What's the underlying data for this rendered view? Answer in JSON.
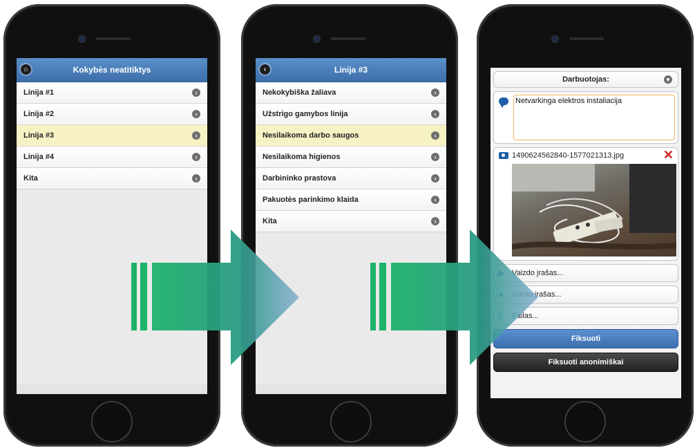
{
  "screen1": {
    "header_title": "Kokybės neatitiktys",
    "items": [
      {
        "label": "Linija #1",
        "selected": false
      },
      {
        "label": "Linija #2",
        "selected": false
      },
      {
        "label": "Linija #3",
        "selected": true
      },
      {
        "label": "Linija #4",
        "selected": false
      },
      {
        "label": "Kita",
        "selected": false
      }
    ]
  },
  "screen2": {
    "header_title": "Linija #3",
    "items": [
      {
        "label": "Nekokybiška žaliava",
        "selected": false
      },
      {
        "label": "Užstrigo gamybos linija",
        "selected": false
      },
      {
        "label": "Nesilaikoma darbo saugos",
        "selected": true
      },
      {
        "label": "Nesilaikoma higienos",
        "selected": false
      },
      {
        "label": "Darbininko prastova",
        "selected": false
      },
      {
        "label": "Pakuotės parinkimo klaida",
        "selected": false
      },
      {
        "label": "Kita",
        "selected": false
      }
    ]
  },
  "screen3": {
    "employee_select": "Darbuotojas:",
    "comment_text": "Netvarkinga elektros instaliacija",
    "attachment_filename": "1490624562840-1577021313.jpg",
    "video_label": "Vaizdo įrašas...",
    "audio_label": "Garso įrašas...",
    "file_label": "Failas...",
    "submit_label": "Fiksuoti",
    "submit_anon_label": "Fiksuoti anonimiškai"
  },
  "colors": {
    "header_blue": "#4a7fbd",
    "selected_row": "#f7f2c4",
    "arrow_green": "#1db36a",
    "delete_red": "#cc2222"
  },
  "icons": {
    "home": "home-icon",
    "back": "back-icon",
    "chevron": "chevron-right-icon",
    "comment": "speech-bubble-icon",
    "camera": "camera-icon",
    "delete": "delete-x-icon",
    "video": "video-camera-icon",
    "audio": "microphone-icon",
    "file": "paperclip-icon"
  }
}
